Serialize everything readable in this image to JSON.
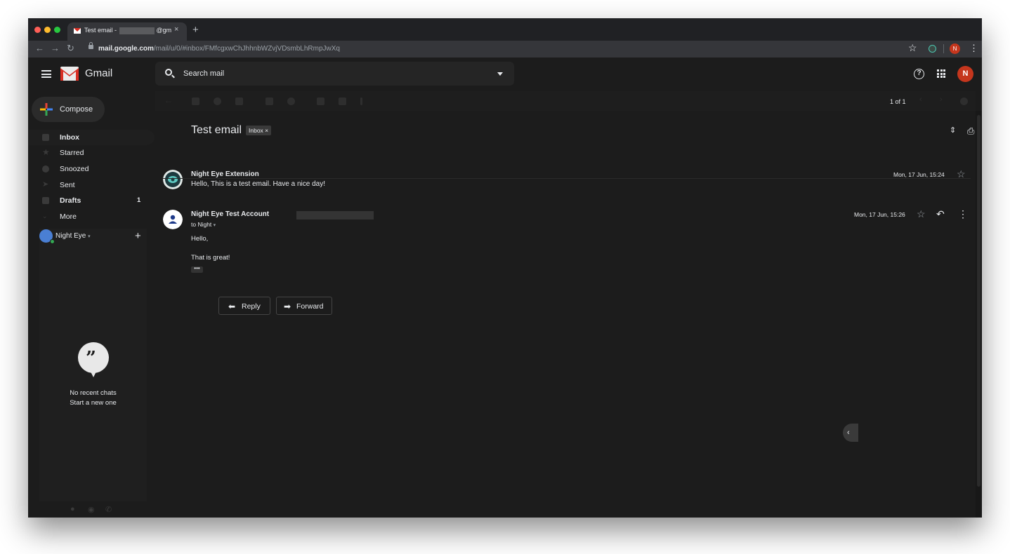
{
  "browser": {
    "tab_title": "Test email - ",
    "tab_title_tail": "@gm",
    "tab_close": "×",
    "new_tab": "+",
    "url_host": "mail.google.com",
    "url_path": "/mail/u/0/#inbox/FMfcgxwChJhhnbWZvjVDsmbLhRmpJwXq",
    "profile_initial": "N"
  },
  "header": {
    "app_name": "Gmail",
    "search_placeholder": "Search mail",
    "help": "?",
    "account_initial": "N"
  },
  "sidebar": {
    "compose_label": "Compose",
    "items": [
      {
        "label": "Inbox",
        "bold": true,
        "count": ""
      },
      {
        "label": "Starred",
        "bold": false,
        "count": ""
      },
      {
        "label": "Snoozed",
        "bold": false,
        "count": ""
      },
      {
        "label": "Sent",
        "bold": false,
        "count": ""
      },
      {
        "label": "Drafts",
        "bold": true,
        "count": "1"
      },
      {
        "label": "More",
        "bold": false,
        "count": ""
      }
    ],
    "hangouts": {
      "user_name": "Night Eye",
      "add": "+",
      "empty_line1": "No recent chats",
      "empty_line2": "Start a new one"
    }
  },
  "toolbar": {
    "pager": "1 of 1"
  },
  "thread": {
    "subject": "Test email",
    "label_chip": "Inbox ×",
    "messages": [
      {
        "sender": "Night Eye Extension",
        "snippet": "Hello, This is a test email. Have a nice day!",
        "date": "Mon, 17 Jun, 15:24"
      },
      {
        "sender": "Night Eye Test Account",
        "to": "to Night",
        "date": "Mon, 17 Jun, 15:26",
        "body_line1": "Hello,",
        "body_line2": "That is great!",
        "trimmed": "•••"
      }
    ],
    "reply_label": "Reply",
    "forward_label": "Forward"
  },
  "colors": {
    "background": "#1c1c1c",
    "avatar_red": "#c5361d",
    "hangouts_green": "#34a853"
  }
}
